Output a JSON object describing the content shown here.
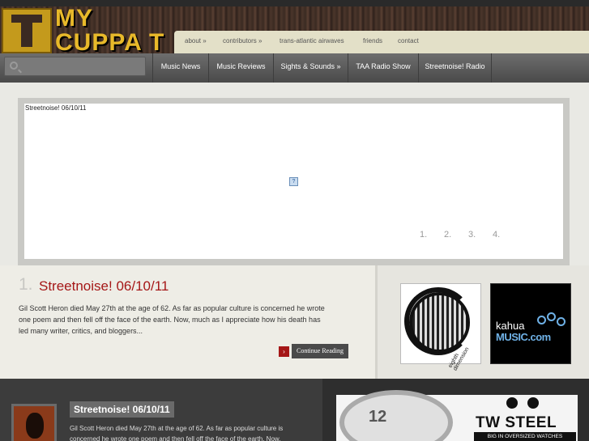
{
  "colors": {
    "accent": "#a51717",
    "logo": "#e8b92a",
    "nav_bg": "#555555",
    "footer_bg": "#3c3c3c"
  },
  "logo": {
    "line1": "MY",
    "line2": "CUPPA T"
  },
  "top_nav": [
    "about »",
    "contributors »",
    "trans-atlantic airwaves",
    "friends",
    "contact"
  ],
  "search": {
    "placeholder": "",
    "icon": "search-icon"
  },
  "main_nav": [
    "Music News",
    "Music Reviews",
    "Sights & Sounds »",
    "TAA Radio Show",
    "Streetnoise! Radio"
  ],
  "slider": {
    "caption": "Streetnoise! 06/10/11",
    "broken_image": "?",
    "pages": [
      "1.",
      "2.",
      "3.",
      "4."
    ]
  },
  "post": {
    "number": "1.",
    "title": "Streetnoise! 06/10/11",
    "excerpt": "Gil Scott Heron died May 27th at the age of 62. As far as popular culture is concerned he wrote one poem and then fell off the face of the earth.  Now, much as I appreciate how his death has led many writer, critics, and bloggers...",
    "continue_label": "Continue Reading",
    "continue_arrow": "›"
  },
  "sidebar_ads": [
    {
      "label": "eighth dimension"
    },
    {
      "line1": "kahua",
      "line2": "MUSIC.com"
    }
  ],
  "footer": {
    "title": "Streetnoise! 06/10/11",
    "excerpt": "Gil Scott Heron died May 27th at the age of 62. As far as popular culture is concerned he wrote one poem and then fell off the face of the earth.  Now,"
  },
  "ad_banner": {
    "watch_text": "12",
    "brand": "TW STEEL",
    "tagline": "BIG IN OVERSIZED WATCHES"
  }
}
